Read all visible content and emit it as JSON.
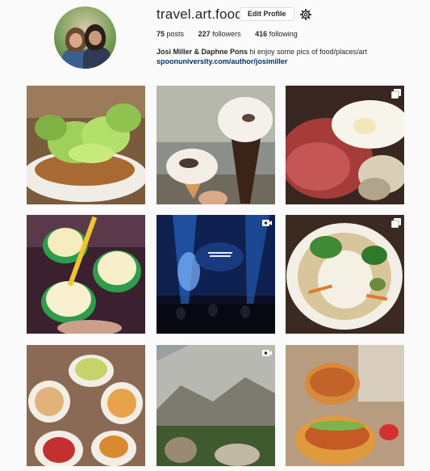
{
  "profile": {
    "username": "travel.art.food",
    "edit_label": "Edit Profile",
    "posts_count": "75",
    "posts_label": "posts",
    "followers_count": "227",
    "followers_label": "followers",
    "following_count": "416",
    "following_label": "following",
    "full_name": "Josi Miller & Daphne Pons",
    "bio_text": "hi enjoy some pics of food/places/art",
    "website": "spoonuniversity.com/author/josimiller"
  },
  "icons": {
    "settings": "gear-icon",
    "multi_photo": "multiple-photos-icon",
    "video": "video-icon"
  },
  "colors": {
    "link": "#003569",
    "border": "#dbdbdb",
    "background": "#fafafa"
  },
  "posts": [
    {
      "subject": "salad with lettuce on fried cutlet"
    },
    {
      "subject": "two ice cream cones"
    },
    {
      "subject": "fried egg with corned beef",
      "overlay": "multiple-photos-icon"
    },
    {
      "subject": "ice cream cups with yellow spoons"
    },
    {
      "subject": "concert stage with blue lights",
      "overlay": "video-icon"
    },
    {
      "subject": "noodle soup bowl with vegetables",
      "overlay": "multiple-photos-icon"
    },
    {
      "subject": "table of plated dishes"
    },
    {
      "subject": "mountain landscape",
      "overlay": "video-icon"
    },
    {
      "subject": "fried chicken sandwiches"
    }
  ]
}
